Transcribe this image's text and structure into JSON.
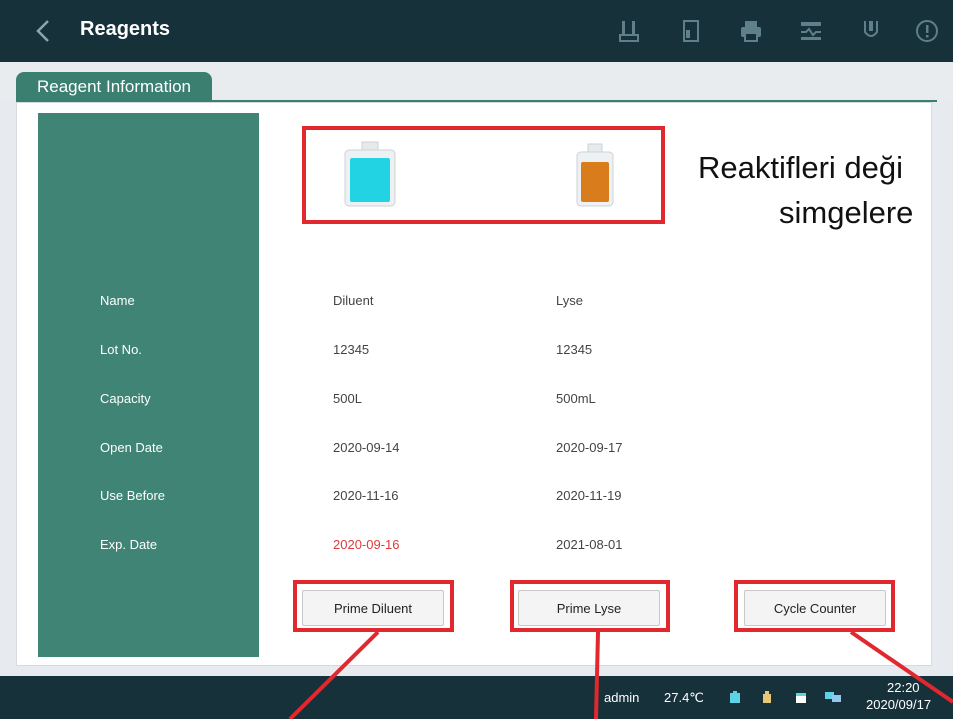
{
  "header": {
    "title": "Reagents",
    "icons": [
      "probe-icon",
      "door-icon",
      "print-icon",
      "calibration-icon",
      "cleaning-icon",
      "info-icon"
    ]
  },
  "tab": {
    "label": "Reagent Information"
  },
  "annotation": {
    "line1": "Reaktifleri deği",
    "line2": "simgelere"
  },
  "bottles": [
    {
      "name": "diluent-bottle",
      "color": "#22d3e3"
    },
    {
      "name": "lyse-bottle",
      "color": "#d97c1c"
    }
  ],
  "rows": [
    {
      "label": "Name",
      "diluent": "Diluent",
      "lyse": "Lyse"
    },
    {
      "label": "Lot No.",
      "diluent": "12345",
      "lyse": "12345"
    },
    {
      "label": "Capacity",
      "diluent": "500L",
      "lyse": "500mL"
    },
    {
      "label": "Open Date",
      "diluent": "2020-09-14",
      "lyse": "2020-09-17"
    },
    {
      "label": "Use Before",
      "diluent": "2020-11-16",
      "lyse": "2020-11-19"
    },
    {
      "label": "Exp. Date",
      "diluent": "2020-09-16",
      "lyse": "2021-08-01"
    }
  ],
  "buttons": {
    "prime_diluent": "Prime Diluent",
    "prime_lyse": "Prime Lyse",
    "cycle_counter": "Cycle Counter"
  },
  "status": {
    "user": "admin",
    "temperature": "27.4℃",
    "time": "22:20",
    "date": "2020/09/17"
  },
  "colors": {
    "header": "#17313a",
    "accent": "#3f8474",
    "highlight": "#e0282e",
    "expired": "#e03a3a"
  }
}
